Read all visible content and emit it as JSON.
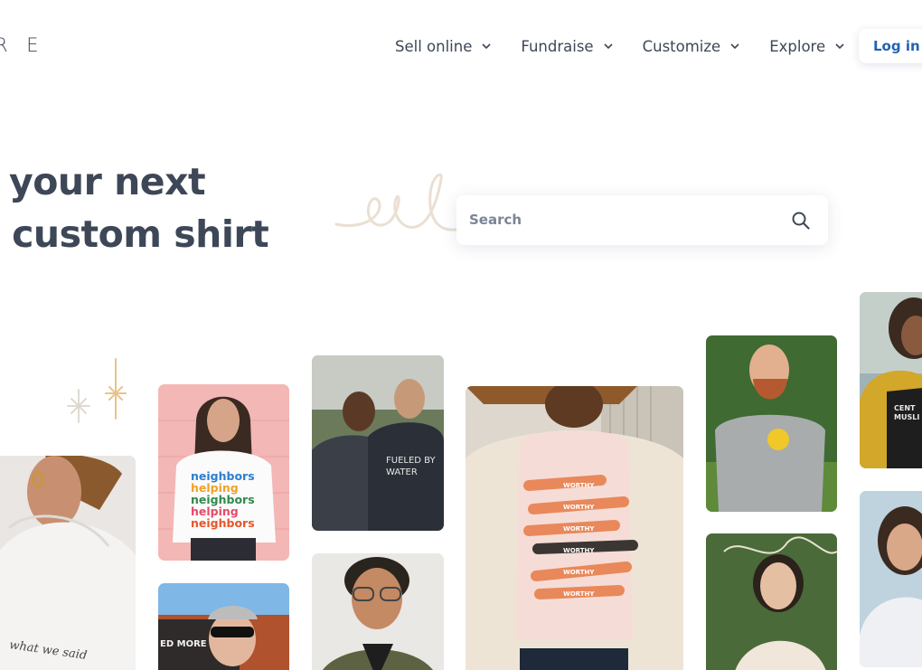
{
  "header": {
    "logo_text": "R E",
    "nav": [
      {
        "label": "Sell online"
      },
      {
        "label": "Fundraise"
      },
      {
        "label": "Customize"
      },
      {
        "label": "Explore"
      }
    ],
    "login_label": "Log in"
  },
  "hero": {
    "line1": "your next",
    "line2": "e custom shirt"
  },
  "search": {
    "placeholder": "Search"
  },
  "photos": {
    "hoodie_caption": "what we said",
    "neighbors_lines": [
      "neighbors",
      "helping",
      "neighbors",
      "helping",
      "neighbors"
    ],
    "fueled_text": "FUELED BY WATER",
    "worthy_lines": [
      "WORTHY",
      "WORTHY",
      "WORTHY",
      "WORTHY",
      "WORTHY",
      "WORTHY"
    ],
    "cap_text": "ED MORE",
    "right_shirt_text": "CENT MUSLI"
  }
}
